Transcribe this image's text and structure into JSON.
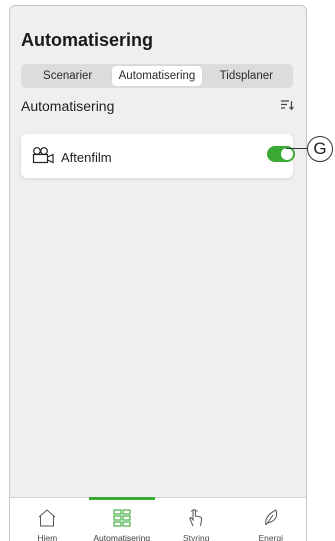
{
  "header": {
    "title": "Automatisering"
  },
  "segments": [
    {
      "label": "Scenarier",
      "active": false
    },
    {
      "label": "Automatisering",
      "active": true
    },
    {
      "label": "Tidsplaner",
      "active": false
    }
  ],
  "section": {
    "title": "Automatisering",
    "sort_icon": "sort-icon"
  },
  "automations": [
    {
      "label": "Aftenfilm",
      "icon": "movie-camera-icon",
      "enabled": true
    }
  ],
  "callout": {
    "letter": "G"
  },
  "tabbar": [
    {
      "label": "Hjem",
      "icon": "home-icon",
      "active": false
    },
    {
      "label": "Automatisering",
      "icon": "grid-icon",
      "active": true
    },
    {
      "label": "Styring",
      "icon": "hand-touch-icon",
      "active": false
    },
    {
      "label": "Energi",
      "icon": "leaf-icon",
      "active": false
    }
  ],
  "colors": {
    "accent": "#3aaa35",
    "background": "#efeff0"
  }
}
